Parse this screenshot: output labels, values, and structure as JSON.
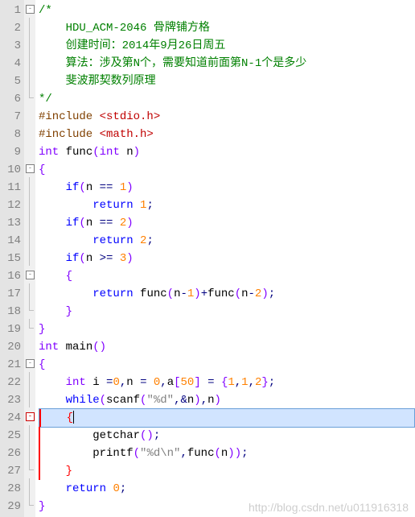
{
  "lines": {
    "l1": "/*",
    "l2_a": "HDU_ACM-2046 骨牌铺方格",
    "l3_a": "创建时间：2014年9月26日周五",
    "l4_a": "算法：涉及第N个，需要知道前面第N-1个是多少",
    "l5_a": "斐波那契数列原理",
    "l6": "*/",
    "l7_pre": "#include ",
    "l7_hdr": "<stdio.h>",
    "l8_pre": "#include ",
    "l8_hdr": "<math.h>",
    "l9_type": "int",
    "l9_name": " func",
    "l9_p1": "(",
    "l9_ptype": "int",
    "l9_pn": " n",
    "l9_p2": ")",
    "l10": "{",
    "l11_if": "if",
    "l11_p1": "(",
    "l11_var": "n ",
    "l11_op": "==",
    "l11_sp": " ",
    "l11_num": "1",
    "l11_p2": ")",
    "l12_kw": "return",
    "l12_sp": " ",
    "l12_num": "1",
    "l12_sc": ";",
    "l13_if": "if",
    "l13_p1": "(",
    "l13_var": "n ",
    "l13_op": "==",
    "l13_sp": " ",
    "l13_num": "2",
    "l13_p2": ")",
    "l14_kw": "return",
    "l14_sp": " ",
    "l14_num": "2",
    "l14_sc": ";",
    "l15_if": "if",
    "l15_p1": "(",
    "l15_var": "n ",
    "l15_op": ">=",
    "l15_sp": " ",
    "l15_num": "3",
    "l15_p2": ")",
    "l16": "{",
    "l17_kw": "return",
    "l17_a": " func",
    "l17_p1": "(",
    "l17_b": "n",
    "l17_op1": "-",
    "l17_n1": "1",
    "l17_p2": ")",
    "l17_op2": "+",
    "l17_c": "func",
    "l17_p3": "(",
    "l17_d": "n",
    "l17_op3": "-",
    "l17_n2": "2",
    "l17_p4": ")",
    "l17_sc": ";",
    "l18": "}",
    "l19": "}",
    "l20_type": "int",
    "l20_name": " main",
    "l20_p": "()",
    "l21": "{",
    "l22_type": "int",
    "l22_a": " i ",
    "l22_op1": "=",
    "l22_n0": "0",
    "l22_c1": ",",
    "l22_b": "n ",
    "l22_op2": "=",
    "l22_sp2": " ",
    "l22_n0b": "0",
    "l22_c2": ",",
    "l22_arr": "a",
    "l22_br": "[",
    "l22_n50": "50",
    "l22_br2": "]",
    "l22_sp3": " ",
    "l22_op3": "=",
    "l22_sp4": " ",
    "l22_cb1": "{",
    "l22_n1": "1",
    "l22_c3": ",",
    "l22_n1b": "1",
    "l22_c4": ",",
    "l22_n2": "2",
    "l22_cb2": "}",
    "l22_sc": ";",
    "l23_kw": "while",
    "l23_p1": "(",
    "l23_fn": "scanf",
    "l23_p2": "(",
    "l23_str": "\"%d\"",
    "l23_c": ",",
    "l23_amp": "&",
    "l23_var": "n",
    "l23_p3": ")",
    "l23_c2": ",",
    "l23_v2": "n",
    "l23_p4": ")",
    "l24": "{",
    "l25_fn": "getchar",
    "l25_p": "()",
    "l25_sc": ";",
    "l26_fn": "printf",
    "l26_p1": "(",
    "l26_str": "\"%d\\n\"",
    "l26_c": ",",
    "l26_fn2": "func",
    "l26_p2": "(",
    "l26_v": "n",
    "l26_p3": "))",
    "l26_sc": ";",
    "l27": "}",
    "l28_kw": "return",
    "l28_sp": " ",
    "l28_num": "0",
    "l28_sc": ";",
    "l29": "}"
  },
  "ln": {
    "1": "1",
    "2": "2",
    "3": "3",
    "4": "4",
    "5": "5",
    "6": "6",
    "7": "7",
    "8": "8",
    "9": "9",
    "10": "10",
    "11": "11",
    "12": "12",
    "13": "13",
    "14": "14",
    "15": "15",
    "16": "16",
    "17": "17",
    "18": "18",
    "19": "19",
    "20": "20",
    "21": "21",
    "22": "22",
    "23": "23",
    "24": "24",
    "25": "25",
    "26": "26",
    "27": "27",
    "28": "28",
    "29": "29"
  },
  "fold_minus": "-",
  "watermark": "http://blog.csdn.net/u011916318"
}
